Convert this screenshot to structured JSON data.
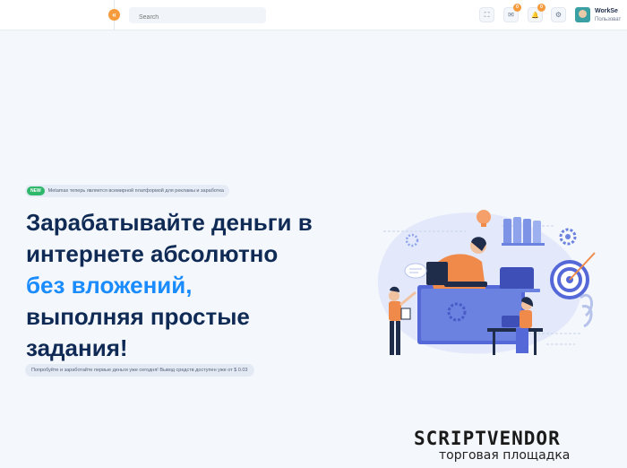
{
  "topbar": {
    "collapse_icon": "«",
    "search_placeholder": "Search",
    "fullscreen_icon": "⛶",
    "mail_icon": "✉",
    "mail_badge": "0",
    "bell_icon": "🔔",
    "bell_badge": "0",
    "settings_icon": "⚙",
    "user_name": "WorkSe",
    "user_role": "Пользоват"
  },
  "hero": {
    "new_tag": "NEW",
    "announcement": "Metamax теперь является всемирной платформой для рекламы и заработка",
    "headline_line1": "Зарабатывайте деньги в",
    "headline_line2": "интернете абсолютно",
    "headline_line3": "без вложений,",
    "headline_line4": "выполняя простые",
    "headline_line5": "задания!",
    "note": "Попробуйте и заработайте первые деньги уже сегодня! Вывод средств доступен уже от $ 0.03"
  },
  "watermark": {
    "line1": "SCRIPTVENDOR",
    "line2": "торговая площадка"
  },
  "colors": {
    "accent_orange": "#f59b3d",
    "headline_dark": "#0f2a55",
    "headline_accent": "#1a8cff",
    "new_badge": "#2fb86b"
  }
}
